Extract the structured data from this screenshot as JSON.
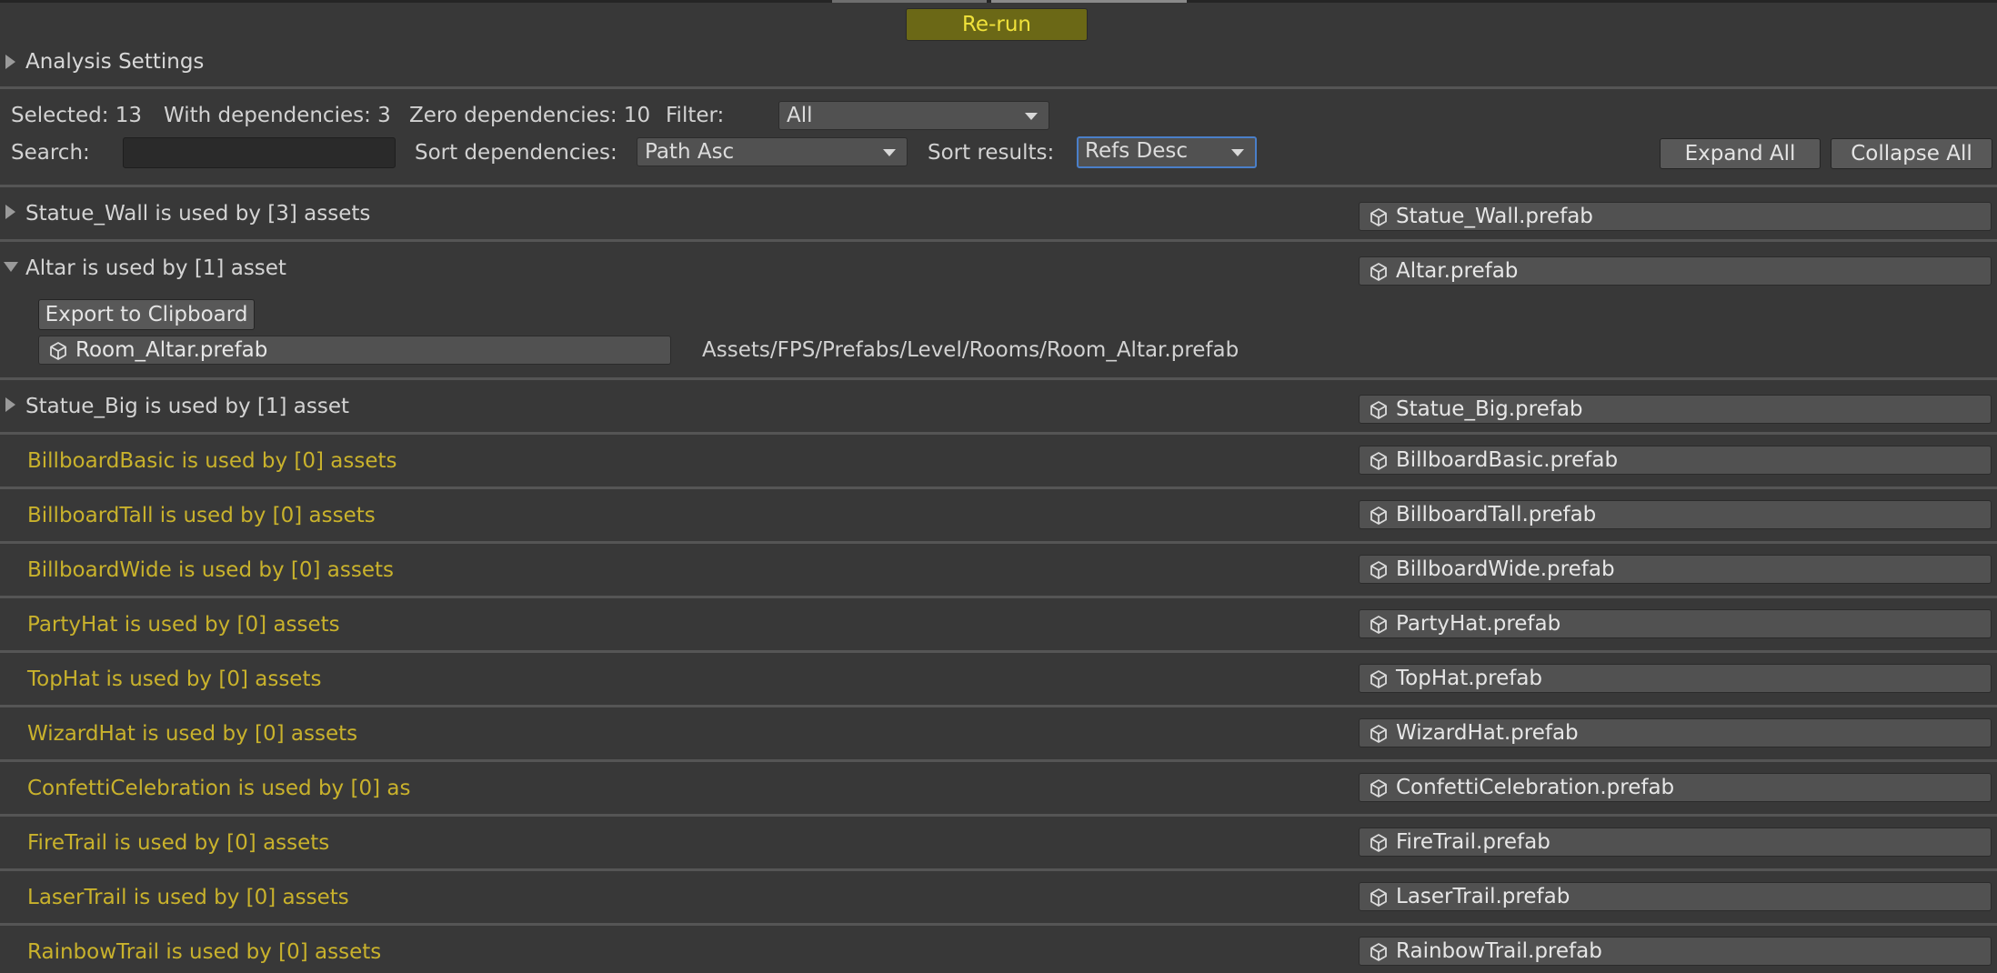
{
  "toolbar": {
    "rerun_label": "Re-run",
    "analysis_settings_label": "Analysis Settings"
  },
  "stats": {
    "selected": "Selected: 13",
    "with_dependencies": "With dependencies: 3",
    "zero_dependencies": "Zero dependencies: 10",
    "filter_label": "Filter:",
    "filter_value": "All",
    "search_label": "Search:",
    "search_value": "",
    "sort_dependencies_label": "Sort dependencies:",
    "sort_dependencies_value": "Path Asc",
    "sort_results_label": "Sort results:",
    "sort_results_value": "Refs Desc",
    "expand_all": "Expand All",
    "collapse_all": "Collapse All"
  },
  "colors": {
    "background": "#383838",
    "zero_dep_text": "#c9b22c",
    "rerun_bg": "#6b6816",
    "rerun_text": "#f0e23a",
    "focus_border": "#4a7fc9"
  },
  "results": [
    {
      "title": "Statue_Wall is used by [3] assets",
      "asset": "Statue_Wall.prefab",
      "expanded": false,
      "zero": false
    },
    {
      "title": "Altar is used by [1] asset",
      "asset": "Altar.prefab",
      "expanded": true,
      "zero": false,
      "export_label": "Export to Clipboard",
      "dependencies": [
        {
          "asset": "Room_Altar.prefab",
          "path": "Assets/FPS/Prefabs/Level/Rooms/Room_Altar.prefab"
        }
      ]
    },
    {
      "title": "Statue_Big is used by [1] asset",
      "asset": "Statue_Big.prefab",
      "expanded": false,
      "zero": false
    },
    {
      "title": "BillboardBasic is used by [0] assets",
      "asset": "BillboardBasic.prefab",
      "zero": true
    },
    {
      "title": "BillboardTall is used by [0] assets",
      "asset": "BillboardTall.prefab",
      "zero": true
    },
    {
      "title": "BillboardWide is used by [0] assets",
      "asset": "BillboardWide.prefab",
      "zero": true
    },
    {
      "title": "PartyHat is used by [0] assets",
      "asset": "PartyHat.prefab",
      "zero": true
    },
    {
      "title": "TopHat is used by [0] assets",
      "asset": "TopHat.prefab",
      "zero": true
    },
    {
      "title": "WizardHat is used by [0] assets",
      "asset": "WizardHat.prefab",
      "zero": true
    },
    {
      "title": "ConfettiCelebration is used by [0] as",
      "asset": "ConfettiCelebration.prefab",
      "zero": true
    },
    {
      "title": "FireTrail is used by [0] assets",
      "asset": "FireTrail.prefab",
      "zero": true
    },
    {
      "title": "LaserTrail is used by [0] assets",
      "asset": "LaserTrail.prefab",
      "zero": true
    },
    {
      "title": "RainbowTrail is used by [0] assets",
      "asset": "RainbowTrail.prefab",
      "zero": true
    }
  ]
}
